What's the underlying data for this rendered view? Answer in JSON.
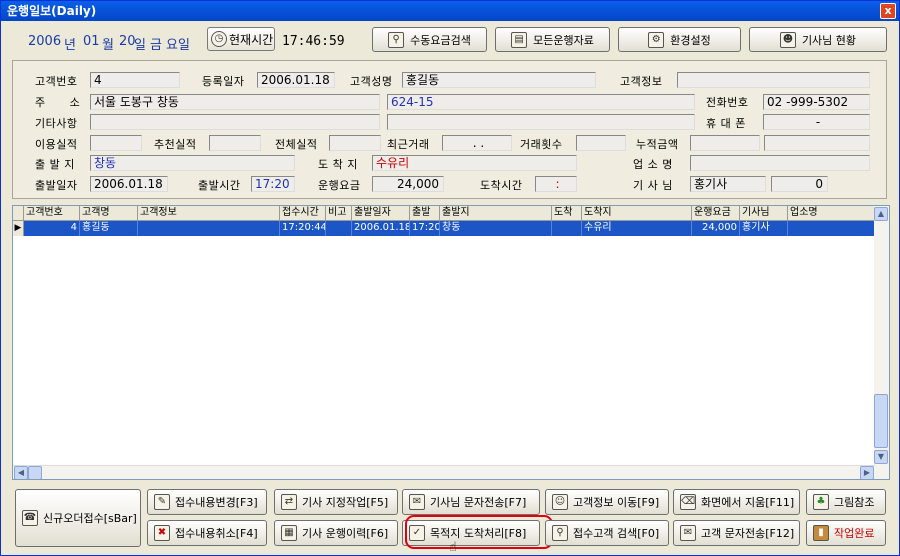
{
  "window": {
    "title": "운행일보(Daily)",
    "close_label": "x"
  },
  "date": {
    "year": "2006",
    "year_suffix": "년",
    "month": "01",
    "month_suffix": "월",
    "day": "20",
    "day_suffix": "일",
    "weekday": "금",
    "weekday_suffix": "요일"
  },
  "now_button": {
    "label": "현재시간",
    "icon": "clock-icon"
  },
  "clock": "17:46:59",
  "toolbar": [
    {
      "label": "수동요금검색",
      "icon": "search-fee-icon"
    },
    {
      "label": "모든운행자료",
      "icon": "data-icon"
    },
    {
      "label": "환경설정",
      "icon": "settings-icon"
    },
    {
      "label": "기사님 현황",
      "icon": "drivers-icon"
    }
  ],
  "form": {
    "customer_no": {
      "label": "고객번호",
      "value": "4"
    },
    "reg_date": {
      "label": "등록일자",
      "value": "2006.01.18"
    },
    "customer_name": {
      "label": "고객성명",
      "value": "홍길동"
    },
    "customer_info": {
      "label": "고객정보",
      "value": ""
    },
    "address": {
      "label": "주      소",
      "value": "서울 도봉구 창동",
      "detail": "624-15"
    },
    "phone": {
      "label": "전화번호",
      "value": "02  -999-5302"
    },
    "other": {
      "label": "기타사항",
      "value": ""
    },
    "mobile": {
      "label": "휴 대 폰",
      "value": "-"
    },
    "usage": {
      "label": "이용실적",
      "value": ""
    },
    "recommend": {
      "label": "추천실적",
      "value": ""
    },
    "total": {
      "label": "전체실적",
      "value": ""
    },
    "recent": {
      "label": "최근거래",
      "value": ". ."
    },
    "trade_count": {
      "label": "거래횟수",
      "value": ""
    },
    "cumulative": {
      "label": "누적금액",
      "value": ""
    },
    "departure": {
      "label": "출 발 지",
      "value": "창동"
    },
    "arrival": {
      "label": "도 착 지",
      "value": "수유리"
    },
    "business": {
      "label": "업 소 명",
      "value": ""
    },
    "dep_date": {
      "label": "출발일자",
      "value": "2006.01.18"
    },
    "dep_time": {
      "label": "출발시간",
      "value": "17:20"
    },
    "fare": {
      "label": "운행요금",
      "value": "24,000"
    },
    "arr_time": {
      "label": "도착시간",
      "value": ":"
    },
    "driver": {
      "label": "기 사 님",
      "value": "홍기사",
      "count": "0"
    }
  },
  "grid": {
    "columns": [
      "고객번호",
      "고객명",
      "고객정보",
      "접수시간",
      "비고",
      "출발일자",
      "출발",
      "출발지",
      "도착",
      "도착지",
      "운행요금",
      "기사님",
      "업소명"
    ],
    "rows": [
      [
        "4",
        "홍길동",
        "",
        "17:20:44",
        "",
        "2006.01.18",
        "17:20",
        "창동",
        "",
        "수유리",
        "24,000",
        "홍기사",
        ""
      ]
    ]
  },
  "buttons": {
    "new_order": "신규오더접수[sBar]",
    "change": "접수내용변경[F3]",
    "cancel": "접수내용취소[F4]",
    "assign": "기사 지정작업[F5]",
    "history": "기사 운행이력[F6]",
    "sms_driver": "기사님 문자전송[F7]",
    "arrive": "목적지 도착처리[F8]",
    "move_info": "고객정보 이동[F9]",
    "search_customer": "접수고객 검색[F0]",
    "clear": "화면에서 지움[F11]",
    "sms_customer": "고객 문자전송[F12]",
    "picture": "그림참조",
    "finish": "작업완료"
  }
}
